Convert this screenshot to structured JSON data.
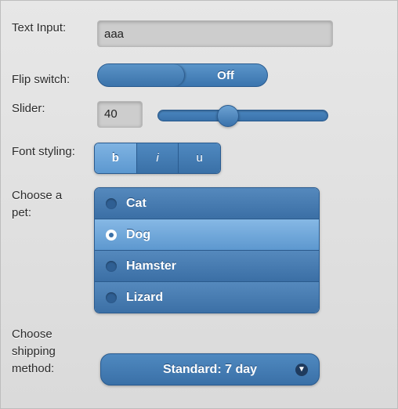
{
  "labels": {
    "text_input": "Text Input:",
    "flip_switch": "Flip switch:",
    "slider": "Slider:",
    "font_styling": "Font styling:",
    "choose_pet_line1": "Choose a",
    "choose_pet_line2": "pet:",
    "shipping_line1": "Choose",
    "shipping_line2": "shipping",
    "shipping_line3": "method:"
  },
  "text_input": {
    "value": "aaa"
  },
  "flip_switch": {
    "state_label": "Off"
  },
  "slider": {
    "value": "40",
    "min": 0,
    "max": 100,
    "level": 40
  },
  "font_styling": {
    "bold": "b",
    "italic": "i",
    "underline": "u",
    "active": "bold"
  },
  "pets": {
    "options": [
      "Cat",
      "Dog",
      "Hamster",
      "Lizard"
    ],
    "selected": "Dog"
  },
  "shipping": {
    "selected": "Standard: 7 day"
  },
  "icons": {
    "select_chevron": "chevron-down-icon"
  }
}
